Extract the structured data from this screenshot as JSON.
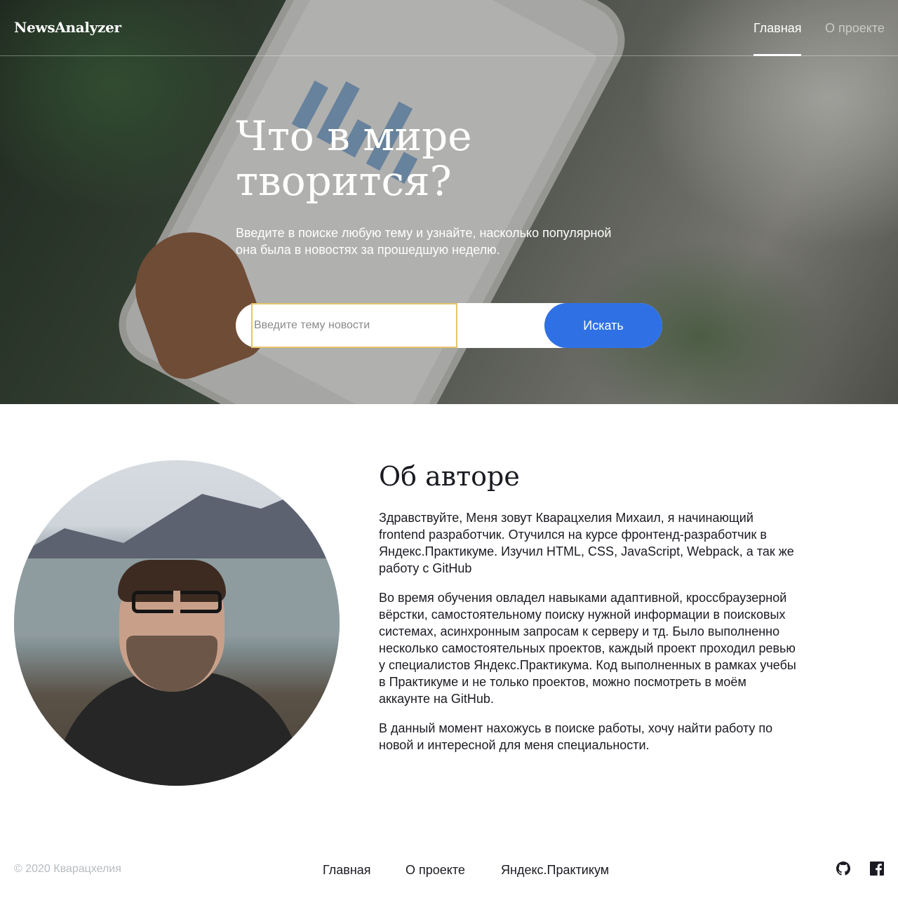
{
  "header": {
    "logo": "NewsAnalyzer",
    "nav": [
      {
        "label": "Главная",
        "active": true
      },
      {
        "label": "О проекте",
        "active": false
      }
    ]
  },
  "hero": {
    "title": "Что в мире творится?",
    "subtitle": "Введите в поиске любую тему и узнайте, насколько популярной она была в новостях за прошедшую неделю.",
    "search": {
      "placeholder": "Введите тему новости",
      "value": "",
      "button_label": "Искать"
    }
  },
  "about": {
    "title": "Об авторе",
    "paragraphs": [
      "Здравствуйте, Меня зовут Кварацхелия Михаил, я начинающий frontend разработчик. Отучился на курсе фронтенд-разработчик в Яндекс.Практикуме. Изучил HTML, CSS, JavaScript, Webpack, а так же работу с GitHub",
      "Во время обучения овладел навыками адаптивной, кроссбраузерной вёрстки, самостоятельному поиску нужной информации в поисковых системах, асинхронным запросам к серверу и тд. Было выполненно несколько самостоятельных проектов, каждый проект проходил ревью у специалистов Яндекс.Практикума. Код выполненных в рамках учебы в Практикуме и не только проектов, можно посмотреть в моём аккаунте на GitHub.",
      "В данный момент нахожусь в поиске работы, хочу найти работу по новой и интересной для меня специальности."
    ]
  },
  "footer": {
    "copyright": "© 2020 Кварацхелия",
    "links": [
      "Главная",
      "О проекте",
      "Яндекс.Практикум"
    ],
    "icons": [
      "github-icon",
      "facebook-icon"
    ]
  },
  "colors": {
    "accent": "#2f71e5",
    "text": "#1a1b22",
    "muted": "#b6bcbf",
    "input_focus_border": "#e4c56a"
  }
}
